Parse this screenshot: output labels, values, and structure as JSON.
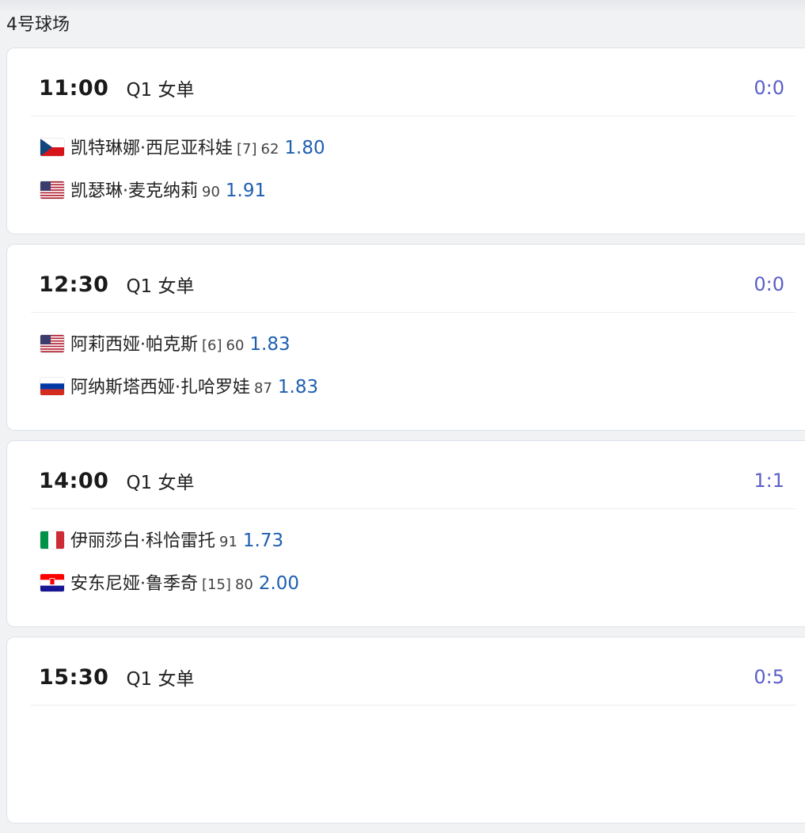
{
  "court": {
    "title": "4号球场"
  },
  "matches": [
    {
      "time": "11:00",
      "round": "Q1 女单",
      "score": "0:0",
      "players": [
        {
          "flag": "czech-flag-icon",
          "name": "凯特琳娜·西尼亚科娃",
          "seed": "[7]",
          "rank": "62",
          "odds": "1.80"
        },
        {
          "flag": "usa-flag-icon",
          "name": "凯瑟琳·麦克纳莉",
          "seed": "",
          "rank": "90",
          "odds": "1.91"
        }
      ]
    },
    {
      "time": "12:30",
      "round": "Q1 女单",
      "score": "0:0",
      "players": [
        {
          "flag": "usa-flag-icon",
          "name": "阿莉西娅·帕克斯",
          "seed": "[6]",
          "rank": "60",
          "odds": "1.83"
        },
        {
          "flag": "russia-flag-icon",
          "name": "阿纳斯塔西娅·扎哈罗娃",
          "seed": "",
          "rank": "87",
          "odds": "1.83"
        }
      ]
    },
    {
      "time": "14:00",
      "round": "Q1 女单",
      "score": "1:1",
      "players": [
        {
          "flag": "italy-flag-icon",
          "name": "伊丽莎白·科恰雷托",
          "seed": "",
          "rank": "91",
          "odds": "1.73"
        },
        {
          "flag": "croatia-flag-icon",
          "name": "安东尼娅·鲁季奇",
          "seed": "[15]",
          "rank": "80",
          "odds": "2.00"
        }
      ]
    },
    {
      "time": "15:30",
      "round": "Q1 女单",
      "score": "0:5"
    }
  ],
  "colors": {
    "score": "#5b5fc7",
    "odds": "#1f5fb0"
  }
}
